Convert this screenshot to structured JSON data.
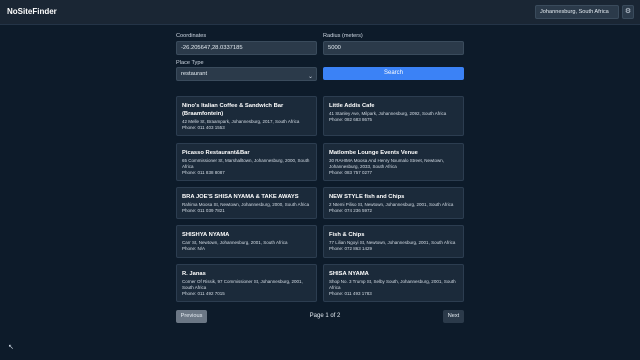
{
  "app": {
    "title": "NoSiteFinder"
  },
  "header": {
    "location_value": "Johannesburg, South Africa",
    "settings_icon": "gear-icon"
  },
  "form": {
    "coordinates_label": "Coordinates",
    "coordinates_value": "-26.205647,28.0337185",
    "radius_label": "Radius (meters)",
    "radius_value": "5000",
    "place_type_label": "Place Type",
    "place_type_value": "restaurant",
    "search_label": "Search"
  },
  "results": [
    {
      "name": "Nino's Italian Coffee & Sandwich Bar (Braamfontein)",
      "address": "42 Melle St, Braampark, Johannesburg, 2017, South Africa",
      "phone": "Phone: 011 403 1553"
    },
    {
      "name": "Little Addis Cafe",
      "address": "41 Stanley Ave, Milpark, Johannesburg, 2092, South Africa",
      "phone": "Phone: 082 683 8675"
    },
    {
      "name": "Picasso Restaurant&Bar",
      "address": "65 Commissioner St, Marshalltown, Johannesburg, 2000, South Africa",
      "phone": "Phone: 011 838 8087"
    },
    {
      "name": "Matlombe Lounge Events Venue",
      "address": "30 RAHIMA Moosa And Henry Nxumalo Street, Newtown, Johannesburg, 2033, South Africa",
      "phone": "Phone: 083 757 0277"
    },
    {
      "name": "BRA JOE'S SHISA NYAMA & TAKE AWAYS",
      "address": "Rahima Moosa St, Newtown, Johannesburg, 2000, South Africa",
      "phone": "Phone: 011 039 7821"
    },
    {
      "name": "NEW STYLE fish and Chips",
      "address": "2 Ntemi Piliso St, Newtown, Johannesburg, 2001, South Africa",
      "phone": "Phone: 074 236 5972"
    },
    {
      "name": "SHISHYA NYAMA",
      "address": "Carr St, Newtown, Johannesburg, 2001, South Africa",
      "phone": "Phone: N/A"
    },
    {
      "name": "Fish & Chips",
      "address": "77 Lilian Ngoyi St, Newtown, Johannesburg, 2001, South Africa",
      "phone": "Phone: 072 863 1429"
    },
    {
      "name": "R. Janas",
      "address": "Corner Of Rissik, 97 Commissioner St, Johannesburg, 2001, South Africa",
      "phone": "Phone: 011 492 7015"
    },
    {
      "name": "SHISA NYAMA",
      "address": "Shop No. 3 Trump St, Selby South, Johannesburg, 2001, South Africa",
      "phone": "Phone: 011 493 1783"
    }
  ],
  "pagination": {
    "previous_label": "Previous",
    "page_info": "Page 1 of 2",
    "next_label": "Next"
  },
  "colors": {
    "background": "#0d1b2a",
    "accent": "#3b82f6",
    "card": "#1b2a3a"
  }
}
